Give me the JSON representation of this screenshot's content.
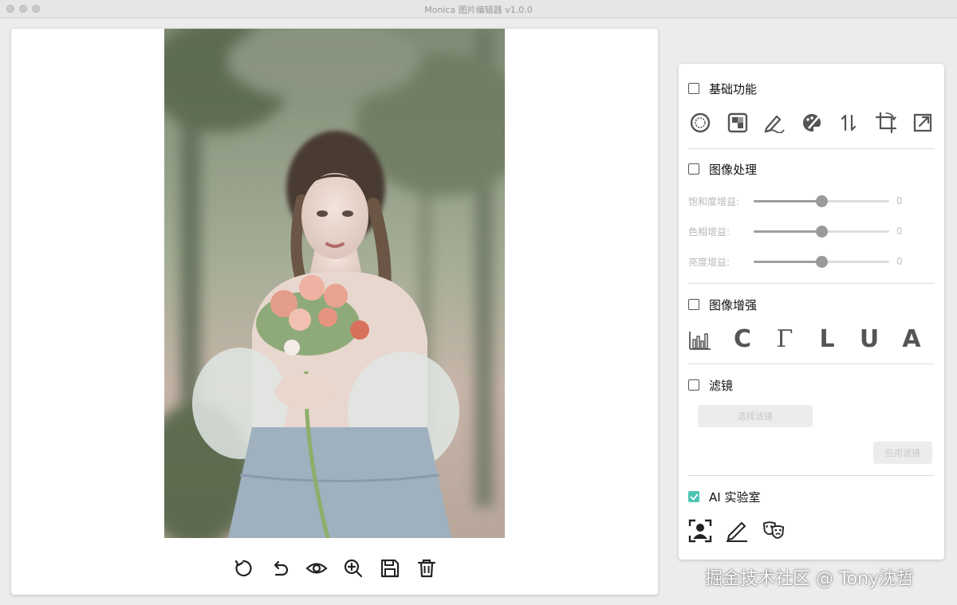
{
  "window": {
    "title": "Monica 图片编辑器 v1.0.0"
  },
  "toolbar": {
    "icons": [
      "reset-icon",
      "undo-icon",
      "eye-icon",
      "zoom-in-icon",
      "save-icon",
      "trash-icon"
    ]
  },
  "sections": {
    "basic": {
      "title": "基础功能",
      "checked": false,
      "icons": [
        "color-picker-icon",
        "mosaic-icon",
        "pen-icon",
        "palette-icon",
        "flip-icon",
        "crop-icon",
        "resize-icon"
      ]
    },
    "processing": {
      "title": "图像处理",
      "checked": false,
      "sliders": [
        {
          "label": "饱和度增益:",
          "value": "0",
          "level": 0.5
        },
        {
          "label": "色相增益:",
          "value": "0",
          "level": 0.5
        },
        {
          "label": "亮度增益:",
          "value": "0",
          "level": 0.5
        }
      ]
    },
    "enhance": {
      "title": "图像增强",
      "checked": false,
      "letters": [
        "C",
        "Γ",
        "L",
        "U",
        "A"
      ]
    },
    "filter": {
      "title": "滤镜",
      "checked": false,
      "select_placeholder": "选择滤镜",
      "apply_label": "应用滤镜"
    },
    "ai": {
      "title": "AI 实验室",
      "checked": true,
      "icons": [
        "face-scan-icon",
        "pencil-sketch-icon",
        "masks-icon"
      ]
    }
  },
  "watermark": "掘金技术社区 @ Tony沈哲",
  "colors": {
    "accent": "#4cc4b4",
    "slider_track": "#dddddd",
    "slider_fill": "#9e9e9e"
  }
}
